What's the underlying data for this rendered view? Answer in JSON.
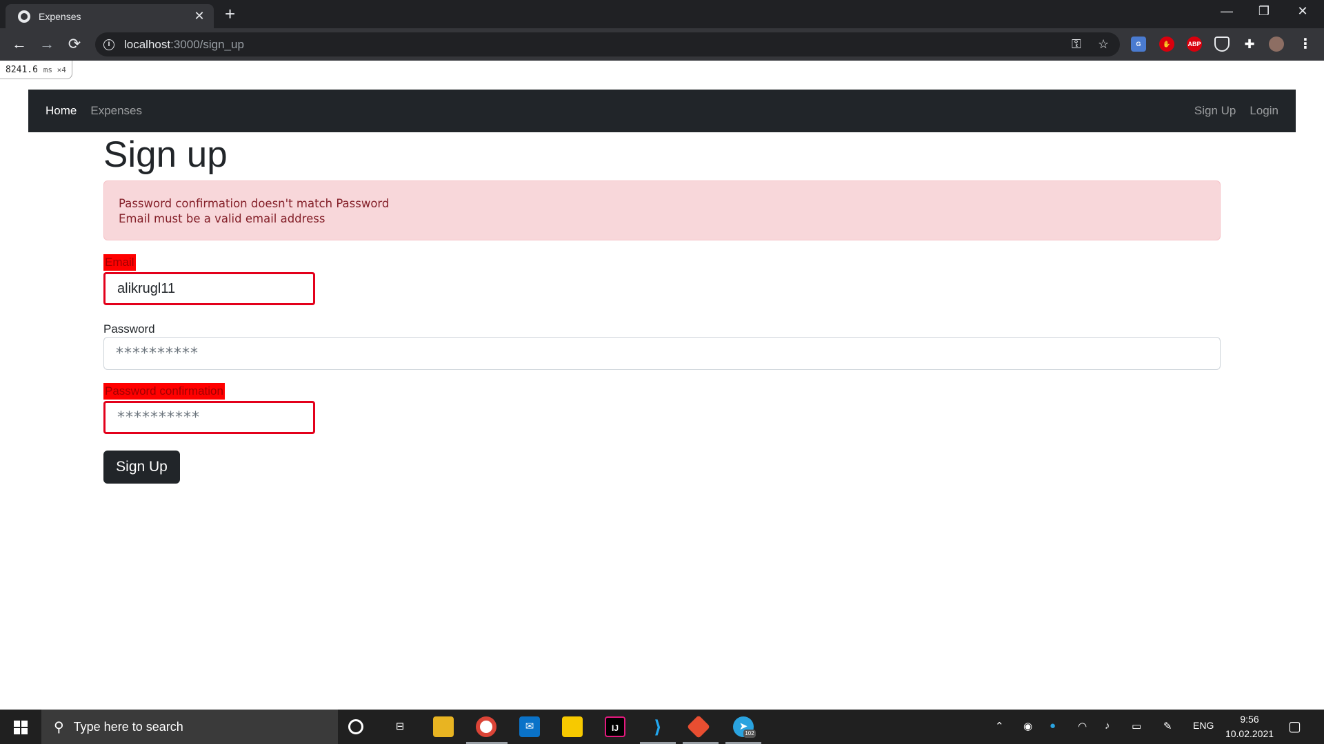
{
  "browser": {
    "tab_title": "Expenses",
    "url_host": "localhost",
    "url_rest": ":3000/sign_up"
  },
  "perf_overlay": {
    "value": "8241.6",
    "unit": "ms ×4"
  },
  "navbar": {
    "left": [
      "Home",
      "Expenses"
    ],
    "right": [
      "Sign Up",
      "Login"
    ],
    "active": "Home"
  },
  "page": {
    "title": "Sign up",
    "errors": [
      "Password confirmation doesn't match Password",
      "Email must be a valid email address"
    ],
    "email_label": "Email",
    "email_value": "alikrugl11",
    "password_label": "Password",
    "password_value": "**********",
    "confirm_label": "Password confirmation",
    "confirm_value": "**********",
    "submit_label": "Sign Up"
  },
  "extensions": {
    "abp": "ABP"
  },
  "taskbar": {
    "search_placeholder": "Type here to search",
    "lang": "ENG",
    "time": "9:56",
    "date": "10.02.2021",
    "telegram_badge": "102"
  },
  "colors": {
    "navbar": "#212529",
    "alert_bg": "#f8d7da",
    "alert_text": "#842029",
    "error_red": "#ff0000"
  }
}
